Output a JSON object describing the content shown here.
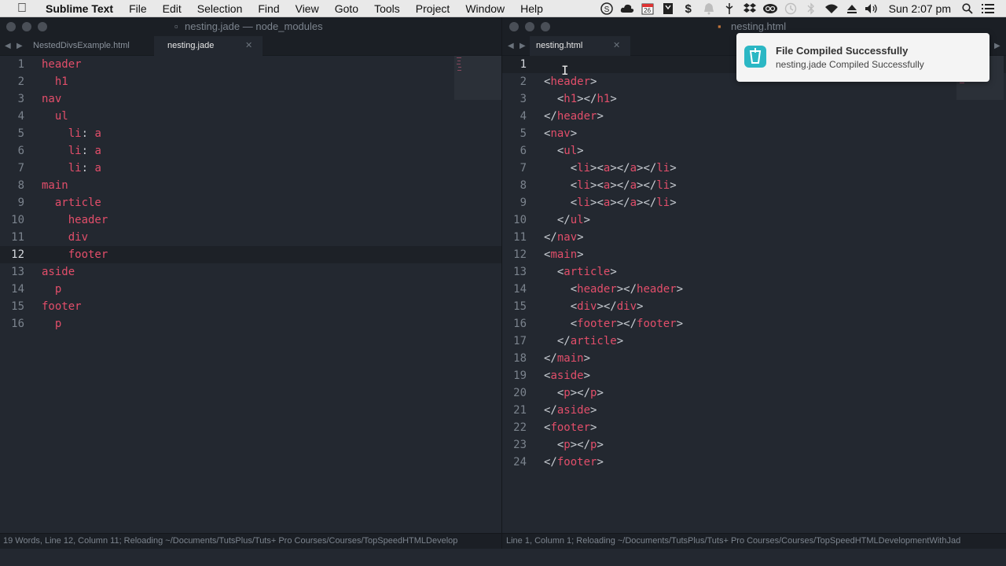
{
  "menubar": {
    "app": "Sublime Text",
    "menus": [
      "File",
      "Edit",
      "Selection",
      "Find",
      "View",
      "Goto",
      "Tools",
      "Project",
      "Window",
      "Help"
    ],
    "calendar_badge": "26",
    "clock": "Sun 2:07 pm"
  },
  "left_window": {
    "title": "nesting.jade — node_modules",
    "tabs": [
      {
        "label": "NestedDivsExample.html",
        "active": false
      },
      {
        "label": "nesting.jade",
        "active": true
      }
    ],
    "active_line": 12,
    "lines": [
      [
        {
          "t": "tag",
          "v": "header"
        }
      ],
      [
        {
          "t": "txt",
          "v": "  "
        },
        {
          "t": "tag",
          "v": "h1"
        }
      ],
      [
        {
          "t": "tag",
          "v": "nav"
        }
      ],
      [
        {
          "t": "txt",
          "v": "  "
        },
        {
          "t": "tag",
          "v": "ul"
        }
      ],
      [
        {
          "t": "txt",
          "v": "    "
        },
        {
          "t": "tag",
          "v": "li"
        },
        {
          "t": "punc",
          "v": ": "
        },
        {
          "t": "tag",
          "v": "a"
        }
      ],
      [
        {
          "t": "txt",
          "v": "    "
        },
        {
          "t": "tag",
          "v": "li"
        },
        {
          "t": "punc",
          "v": ": "
        },
        {
          "t": "tag",
          "v": "a"
        }
      ],
      [
        {
          "t": "txt",
          "v": "    "
        },
        {
          "t": "tag",
          "v": "li"
        },
        {
          "t": "punc",
          "v": ": "
        },
        {
          "t": "tag",
          "v": "a"
        }
      ],
      [
        {
          "t": "tag",
          "v": "main"
        }
      ],
      [
        {
          "t": "txt",
          "v": "  "
        },
        {
          "t": "tag",
          "v": "article"
        }
      ],
      [
        {
          "t": "txt",
          "v": "    "
        },
        {
          "t": "tag",
          "v": "header"
        }
      ],
      [
        {
          "t": "txt",
          "v": "    "
        },
        {
          "t": "tag",
          "v": "div"
        }
      ],
      [
        {
          "t": "txt",
          "v": "    "
        },
        {
          "t": "tag",
          "v": "footer"
        }
      ],
      [
        {
          "t": "tag",
          "v": "aside"
        }
      ],
      [
        {
          "t": "txt",
          "v": "  "
        },
        {
          "t": "tag",
          "v": "p"
        }
      ],
      [
        {
          "t": "tag",
          "v": "footer"
        }
      ],
      [
        {
          "t": "txt",
          "v": "  "
        },
        {
          "t": "tag",
          "v": "p"
        }
      ]
    ],
    "status": "19 Words, Line 12, Column 11; Reloading ~/Documents/TutsPlus/Tuts+ Pro Courses/Courses/TopSpeedHTMLDevelop"
  },
  "right_window": {
    "title": "nesting.html",
    "tabs": [
      {
        "label": "nesting.html",
        "active": true
      }
    ],
    "active_line": 1,
    "lines": [
      [],
      [
        {
          "t": "punc",
          "v": "<"
        },
        {
          "t": "tag",
          "v": "header"
        },
        {
          "t": "punc",
          "v": ">"
        }
      ],
      [
        {
          "t": "txt",
          "v": "  "
        },
        {
          "t": "punc",
          "v": "<"
        },
        {
          "t": "tag",
          "v": "h1"
        },
        {
          "t": "punc",
          "v": "></"
        },
        {
          "t": "tag",
          "v": "h1"
        },
        {
          "t": "punc",
          "v": ">"
        }
      ],
      [
        {
          "t": "punc",
          "v": "</"
        },
        {
          "t": "tag",
          "v": "header"
        },
        {
          "t": "punc",
          "v": ">"
        }
      ],
      [
        {
          "t": "punc",
          "v": "<"
        },
        {
          "t": "tag",
          "v": "nav"
        },
        {
          "t": "punc",
          "v": ">"
        }
      ],
      [
        {
          "t": "txt",
          "v": "  "
        },
        {
          "t": "punc",
          "v": "<"
        },
        {
          "t": "tag",
          "v": "ul"
        },
        {
          "t": "punc",
          "v": ">"
        }
      ],
      [
        {
          "t": "txt",
          "v": "    "
        },
        {
          "t": "punc",
          "v": "<"
        },
        {
          "t": "tag",
          "v": "li"
        },
        {
          "t": "punc",
          "v": "><"
        },
        {
          "t": "tag",
          "v": "a"
        },
        {
          "t": "punc",
          "v": "></"
        },
        {
          "t": "tag",
          "v": "a"
        },
        {
          "t": "punc",
          "v": "></"
        },
        {
          "t": "tag",
          "v": "li"
        },
        {
          "t": "punc",
          "v": ">"
        }
      ],
      [
        {
          "t": "txt",
          "v": "    "
        },
        {
          "t": "punc",
          "v": "<"
        },
        {
          "t": "tag",
          "v": "li"
        },
        {
          "t": "punc",
          "v": "><"
        },
        {
          "t": "tag",
          "v": "a"
        },
        {
          "t": "punc",
          "v": "></"
        },
        {
          "t": "tag",
          "v": "a"
        },
        {
          "t": "punc",
          "v": "></"
        },
        {
          "t": "tag",
          "v": "li"
        },
        {
          "t": "punc",
          "v": ">"
        }
      ],
      [
        {
          "t": "txt",
          "v": "    "
        },
        {
          "t": "punc",
          "v": "<"
        },
        {
          "t": "tag",
          "v": "li"
        },
        {
          "t": "punc",
          "v": "><"
        },
        {
          "t": "tag",
          "v": "a"
        },
        {
          "t": "punc",
          "v": "></"
        },
        {
          "t": "tag",
          "v": "a"
        },
        {
          "t": "punc",
          "v": "></"
        },
        {
          "t": "tag",
          "v": "li"
        },
        {
          "t": "punc",
          "v": ">"
        }
      ],
      [
        {
          "t": "txt",
          "v": "  "
        },
        {
          "t": "punc",
          "v": "</"
        },
        {
          "t": "tag",
          "v": "ul"
        },
        {
          "t": "punc",
          "v": ">"
        }
      ],
      [
        {
          "t": "punc",
          "v": "</"
        },
        {
          "t": "tag",
          "v": "nav"
        },
        {
          "t": "punc",
          "v": ">"
        }
      ],
      [
        {
          "t": "punc",
          "v": "<"
        },
        {
          "t": "tag",
          "v": "main"
        },
        {
          "t": "punc",
          "v": ">"
        }
      ],
      [
        {
          "t": "txt",
          "v": "  "
        },
        {
          "t": "punc",
          "v": "<"
        },
        {
          "t": "tag",
          "v": "article"
        },
        {
          "t": "punc",
          "v": ">"
        }
      ],
      [
        {
          "t": "txt",
          "v": "    "
        },
        {
          "t": "punc",
          "v": "<"
        },
        {
          "t": "tag",
          "v": "header"
        },
        {
          "t": "punc",
          "v": "></"
        },
        {
          "t": "tag",
          "v": "header"
        },
        {
          "t": "punc",
          "v": ">"
        }
      ],
      [
        {
          "t": "txt",
          "v": "    "
        },
        {
          "t": "punc",
          "v": "<"
        },
        {
          "t": "tag",
          "v": "div"
        },
        {
          "t": "punc",
          "v": "></"
        },
        {
          "t": "tag",
          "v": "div"
        },
        {
          "t": "punc",
          "v": ">"
        }
      ],
      [
        {
          "t": "txt",
          "v": "    "
        },
        {
          "t": "punc",
          "v": "<"
        },
        {
          "t": "tag",
          "v": "footer"
        },
        {
          "t": "punc",
          "v": "></"
        },
        {
          "t": "tag",
          "v": "footer"
        },
        {
          "t": "punc",
          "v": ">"
        }
      ],
      [
        {
          "t": "txt",
          "v": "  "
        },
        {
          "t": "punc",
          "v": "</"
        },
        {
          "t": "tag",
          "v": "article"
        },
        {
          "t": "punc",
          "v": ">"
        }
      ],
      [
        {
          "t": "punc",
          "v": "</"
        },
        {
          "t": "tag",
          "v": "main"
        },
        {
          "t": "punc",
          "v": ">"
        }
      ],
      [
        {
          "t": "punc",
          "v": "<"
        },
        {
          "t": "tag",
          "v": "aside"
        },
        {
          "t": "punc",
          "v": ">"
        }
      ],
      [
        {
          "t": "txt",
          "v": "  "
        },
        {
          "t": "punc",
          "v": "<"
        },
        {
          "t": "tag",
          "v": "p"
        },
        {
          "t": "punc",
          "v": "></"
        },
        {
          "t": "tag",
          "v": "p"
        },
        {
          "t": "punc",
          "v": ">"
        }
      ],
      [
        {
          "t": "punc",
          "v": "</"
        },
        {
          "t": "tag",
          "v": "aside"
        },
        {
          "t": "punc",
          "v": ">"
        }
      ],
      [
        {
          "t": "punc",
          "v": "<"
        },
        {
          "t": "tag",
          "v": "footer"
        },
        {
          "t": "punc",
          "v": ">"
        }
      ],
      [
        {
          "t": "txt",
          "v": "  "
        },
        {
          "t": "punc",
          "v": "<"
        },
        {
          "t": "tag",
          "v": "p"
        },
        {
          "t": "punc",
          "v": "></"
        },
        {
          "t": "tag",
          "v": "p"
        },
        {
          "t": "punc",
          "v": ">"
        }
      ],
      [
        {
          "t": "punc",
          "v": "</"
        },
        {
          "t": "tag",
          "v": "footer"
        },
        {
          "t": "punc",
          "v": ">"
        }
      ]
    ],
    "status": "Line 1, Column 1; Reloading ~/Documents/TutsPlus/Tuts+ Pro Courses/Courses/TopSpeedHTMLDevelopmentWithJad"
  },
  "notification": {
    "title": "File Compiled Successfully",
    "body": "nesting.jade Compiled Successfully",
    "icon": "gulp-app-icon"
  },
  "colors": {
    "editor_bg": "#232830",
    "tag": "#e24e6a",
    "punctuation": "#c9cdd3",
    "gutter": "#7b838d"
  }
}
